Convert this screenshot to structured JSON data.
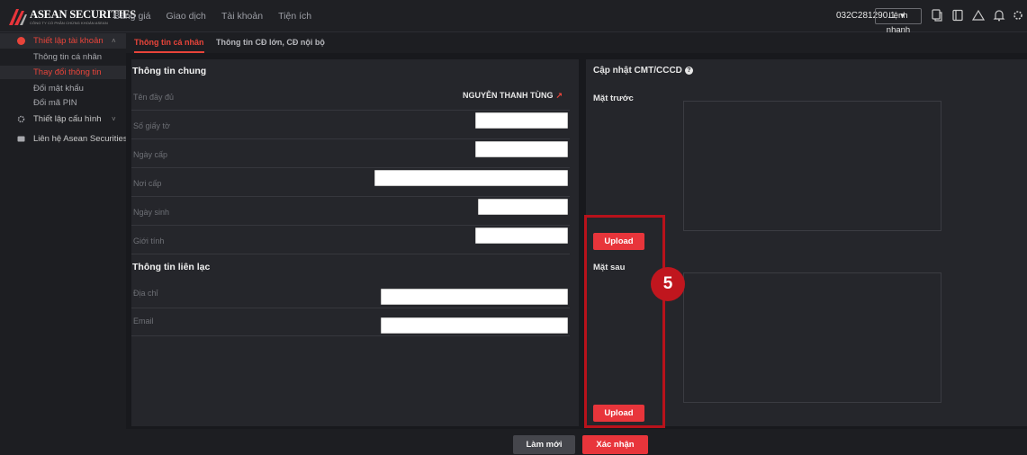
{
  "header": {
    "logo_text": "ASEAN SECURITIES",
    "logo_subtitle": "CÔNG TY CỔ PHẦN CHỨNG KHOÁN ASEAN",
    "nav": [
      "Bảng giá",
      "Giao dịch",
      "Tài khoản",
      "Tiện ích"
    ],
    "account": "032C281290.1",
    "quick_order_label": "Lệnh nhanh",
    "icons": [
      "copy-icon",
      "book-icon",
      "warning-icon",
      "bell-icon",
      "settings-icon"
    ]
  },
  "sidebar": {
    "groups": [
      {
        "label": "Thiết lập tài khoản",
        "icon": "user-icon",
        "expanded": true
      },
      {
        "label": "Thiết lập cấu hình",
        "icon": "gear-icon",
        "expanded": false
      },
      {
        "label": "Liên hệ Asean Securities",
        "icon": "contact-icon"
      }
    ],
    "items": [
      "Thông tin cá nhân",
      "Thay đổi thông tin",
      "Đổi mật khẩu",
      "Đổi mã PIN"
    ]
  },
  "tabs": [
    "Thông tin cá nhân",
    "Thông tin CĐ lớn, CĐ nội bộ"
  ],
  "general": {
    "title": "Thông tin chung",
    "fields": [
      {
        "label": "Tên đầy đủ",
        "value": "NGUYỄN THANH TÙNG"
      },
      {
        "label": "Số giấy tờ",
        "value": ""
      },
      {
        "label": "Ngày cấp",
        "value": ""
      },
      {
        "label": "Nơi cấp",
        "value": ""
      },
      {
        "label": "Ngày sinh",
        "value": ""
      },
      {
        "label": "Giới tính",
        "value": ""
      }
    ]
  },
  "contact": {
    "title": "Thông tin liên lạc",
    "fields": [
      {
        "label": "Địa chỉ",
        "value": ""
      },
      {
        "label": "Email",
        "value": ""
      }
    ]
  },
  "id_update": {
    "title": "Cập nhật CMT/CCCD",
    "front_label": "Mặt trước",
    "back_label": "Mặt sau",
    "upload_label": "Upload"
  },
  "annotation": {
    "step": "5"
  },
  "footer": {
    "reset_label": "Làm mới",
    "confirm_label": "Xác nhận"
  },
  "colors": {
    "accent": "#e8353b",
    "background": "#18191d",
    "panel": "#25262b",
    "highlight": "#b8121b"
  }
}
